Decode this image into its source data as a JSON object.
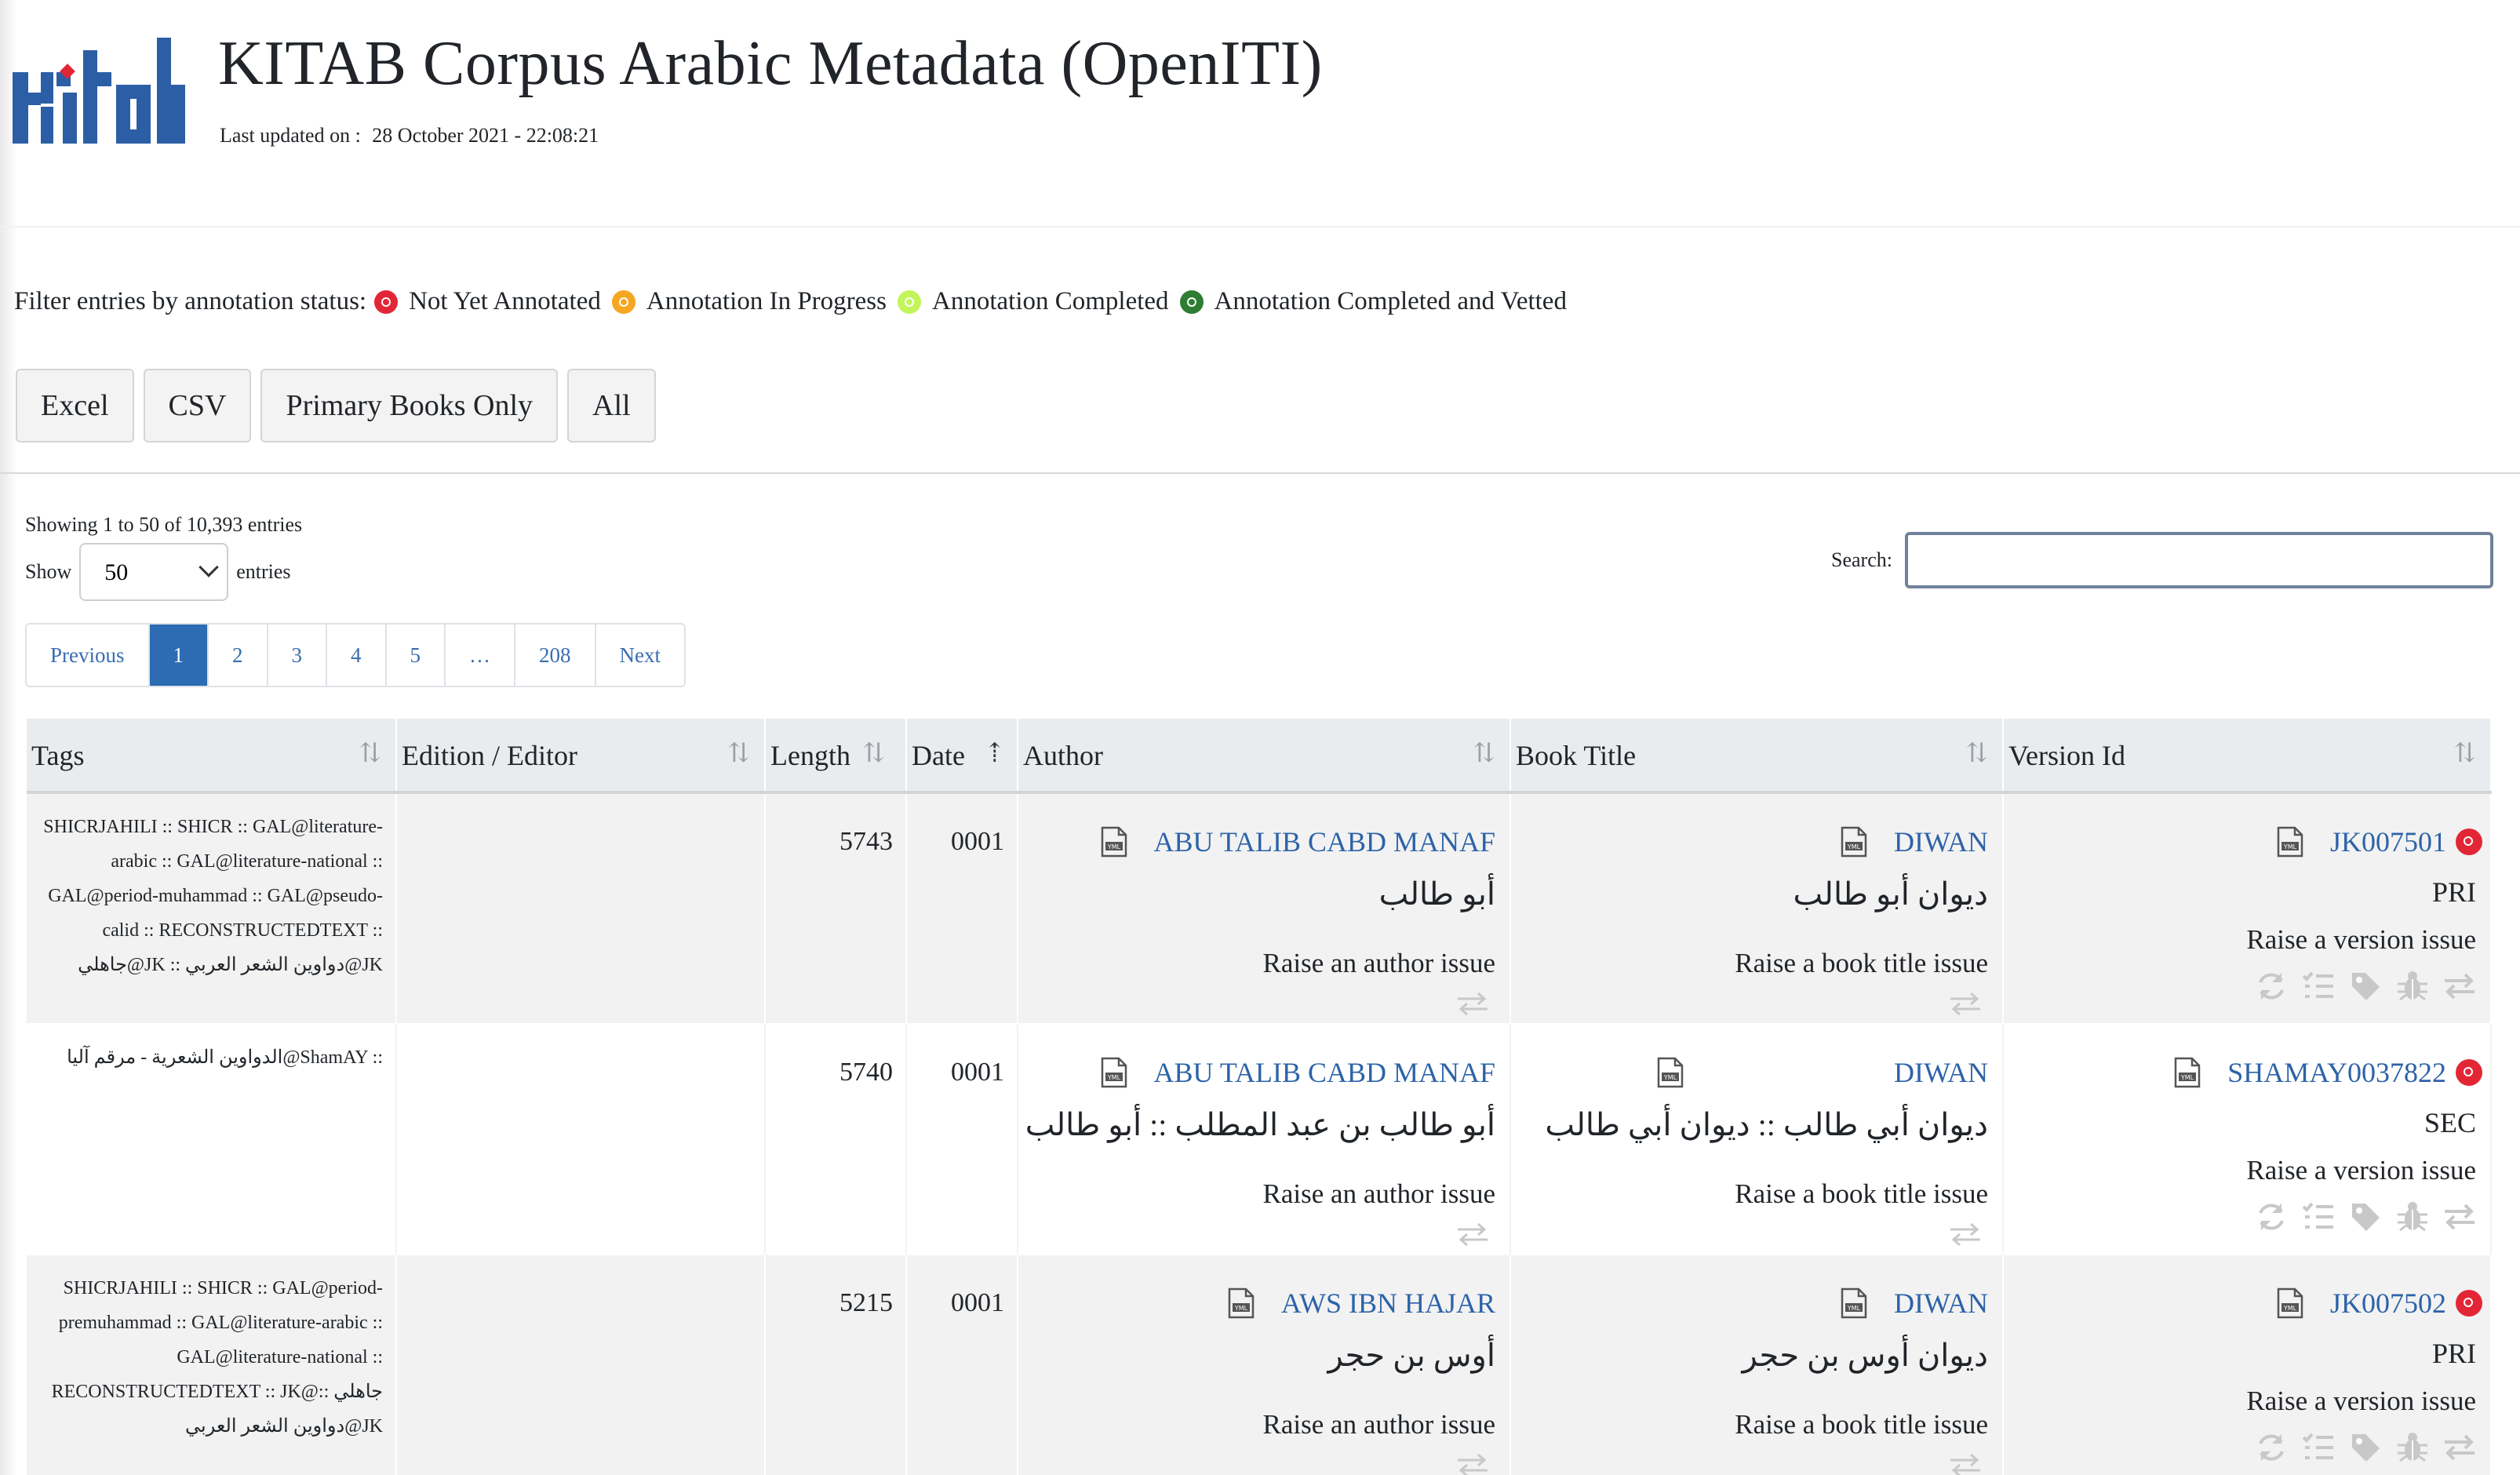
{
  "header": {
    "title": "KITAB Corpus Arabic Metadata (OpenITI)",
    "updated_label": "Last updated on :",
    "updated_value": "28 October 2021 - 22:08:21",
    "brand_color": "#2c5ea5"
  },
  "filter": {
    "label": "Filter entries by annotation status:",
    "items": [
      {
        "label": "Not Yet Annotated",
        "color": "#e32636"
      },
      {
        "label": "Annotation In Progress",
        "color": "#f5a623"
      },
      {
        "label": "Annotation Completed",
        "color": "#c3f55a"
      },
      {
        "label": "Annotation Completed and Vetted",
        "color": "#2e7d32"
      }
    ]
  },
  "buttons": [
    "Excel",
    "CSV",
    "Primary Books Only",
    "All"
  ],
  "info": "Showing 1 to 50 of 10,393 entries",
  "length": {
    "show_label": "Show",
    "value": "50",
    "entries_label": "entries"
  },
  "search": {
    "label": "Search:",
    "value": ""
  },
  "pagination": [
    "Previous",
    "1",
    "2",
    "3",
    "4",
    "5",
    "…",
    "208",
    "Next"
  ],
  "columns": [
    "Tags",
    "Edition / Editor",
    "Length",
    "Date",
    "Author",
    "Book Title",
    "Version Id"
  ],
  "rows": [
    {
      "tags": "SHICRJAHILI :: SHICR :: GAL@literature-arabic :: GAL@literature-national :: GAL@period-muhammad :: GAL@pseudo-calid :: RECONSTRUCTEDTEXT :: جاهلي@JK :: دواوين الشعر العربي@JK",
      "editor": "",
      "length": "5743",
      "date": "0001",
      "author": "ABU TALIB CABD MANAF",
      "author_ar": "أبو طالب",
      "author_issue": "Raise an author issue",
      "book": "DIWAN",
      "book_ar": "ديوان أبو طالب",
      "book_issue": "Raise a book title issue",
      "version": "JK007501",
      "version_type": "PRI",
      "version_issue": "Raise a version issue"
    },
    {
      "tags": "الدواوين الشعرية - مرقم آليا@ShamAY ::",
      "editor": "",
      "length": "5740",
      "date": "0001",
      "author": "ABU TALIB CABD MANAF",
      "author_ar": "أبو طالب بن عبد المطلب :: أبو طالب",
      "author_issue": "Raise an author issue",
      "book": "DIWAN",
      "book_ar": "ديوان أبي طالب :: ديوان أبي طالب",
      "book_issue": "Raise a book title issue",
      "version": "SHAMAY0037822",
      "version_type": "SEC",
      "version_issue": "Raise a version issue"
    },
    {
      "tags": "SHICRJAHILI :: SHICR :: GAL@period-premuhammad :: GAL@literature-arabic :: GAL@literature-national :: RECONSTRUCTEDTEXT :: JK@جاهلي :: دواوين الشعر العربي@JK",
      "editor": "",
      "length": "5215",
      "date": "0001",
      "author": "AWS IBN HAJAR",
      "author_ar": "أوس بن حجر",
      "author_issue": "Raise an author issue",
      "book": "DIWAN",
      "book_ar": "ديوان أوس بن حجر",
      "book_issue": "Raise a book title issue",
      "version": "JK007502",
      "version_type": "PRI",
      "version_issue": "Raise a version issue"
    }
  ]
}
